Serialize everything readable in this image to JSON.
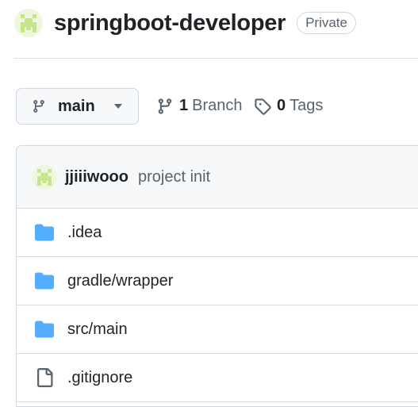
{
  "repo": {
    "name": "springboot-developer",
    "visibility": "Private"
  },
  "branch": {
    "current": "main",
    "branch_count": "1",
    "branch_label": "Branch",
    "tag_count": "0",
    "tag_label": "Tags"
  },
  "commit": {
    "author": "jjiiiwooo",
    "message": "project init"
  },
  "files": [
    {
      "name": ".idea",
      "type": "folder",
      "icon": "folder-icon"
    },
    {
      "name": "gradle/wrapper",
      "type": "folder",
      "icon": "folder-icon"
    },
    {
      "name": "src/main",
      "type": "folder",
      "icon": "folder-icon"
    },
    {
      "name": ".gitignore",
      "type": "file",
      "icon": "file-icon"
    }
  ],
  "colors": {
    "folder": "#54aeff",
    "avatar": "#c6e48b",
    "text_muted": "#59636e",
    "border": "#d0d7de"
  }
}
